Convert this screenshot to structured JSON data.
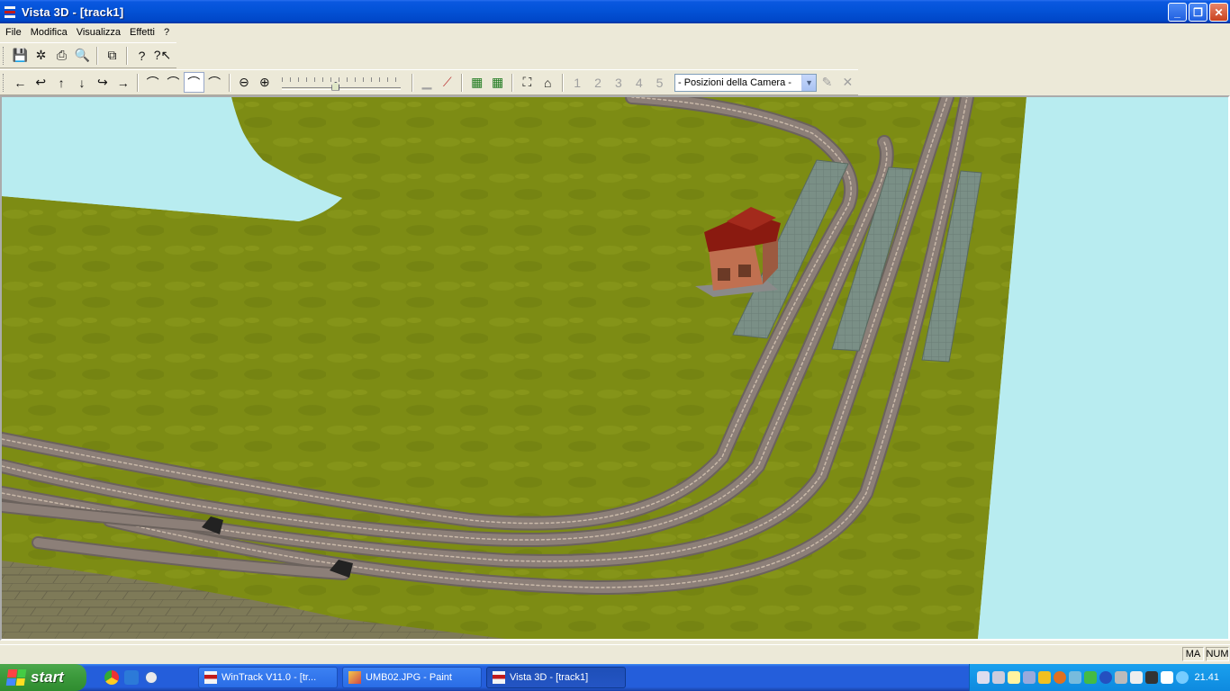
{
  "window": {
    "title": "Vista 3D - [track1]",
    "controls": {
      "minimize": "_",
      "restore": "❐",
      "close": "✕"
    }
  },
  "menu": {
    "items": [
      "File",
      "Modifica",
      "Visualizza",
      "Effetti",
      "?"
    ]
  },
  "toolbar1": {
    "buttons": [
      {
        "name": "save-icon",
        "glyph": "💾"
      },
      {
        "name": "export-icon",
        "glyph": "✲"
      },
      {
        "name": "print-icon",
        "glyph": "⎙"
      },
      {
        "name": "print-preview-icon",
        "glyph": "🔍"
      },
      {
        "name": "copy-icon",
        "glyph": "⧉"
      },
      {
        "name": "help-icon",
        "glyph": "?"
      },
      {
        "name": "context-help-icon",
        "glyph": "?↖"
      }
    ]
  },
  "toolbar2": {
    "nav": [
      "←",
      "↩",
      "↑",
      "↓",
      "↪",
      "→"
    ],
    "camera_modes": [
      "⌒",
      "⌒",
      "⌒",
      "⌒"
    ],
    "zoom": {
      "out": "⊖",
      "in": "⊕"
    },
    "zoom_level": 0.45,
    "scene_tools": [
      "▁",
      "⟋"
    ],
    "terrain_tools": [
      "▦",
      "▦"
    ],
    "view_tools": [
      "⛶",
      "⌂"
    ],
    "camera_positions": [
      "1",
      "2",
      "3",
      "4",
      "5"
    ],
    "camera_select": {
      "value": "- Posizioni della Camera -"
    }
  },
  "status": {
    "caps": "MA",
    "num": "NUM"
  },
  "taskbar": {
    "start_label": "start",
    "tasks": [
      {
        "label": "WinTrack  V11.0 - [tr...",
        "active": false
      },
      {
        "label": "UMB02.JPG - Paint",
        "active": false
      },
      {
        "label": "Vista 3D - [track1]",
        "active": true
      }
    ],
    "clock": "21.41"
  },
  "colors": {
    "grass": "#7d8c14",
    "sky": "#b8ecf0",
    "track": "#8c7f78",
    "platform": "#7a8f86",
    "station_roof": "#8a1a10",
    "station_wall": "#c07050",
    "paving": "#7e7a58"
  }
}
